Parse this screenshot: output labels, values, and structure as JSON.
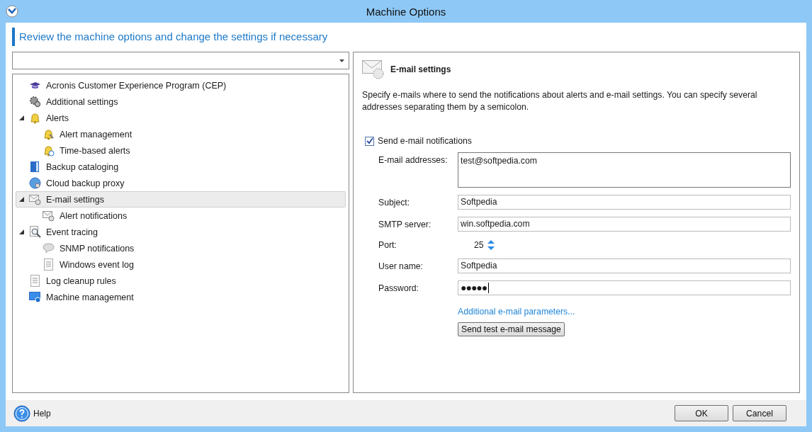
{
  "window": {
    "title": "Machine Options"
  },
  "header": "Review the machine options and change the settings if necessary",
  "tree": [
    {
      "label": "Acronis Customer Experience Program (CEP)",
      "kind": "program",
      "selected": false
    },
    {
      "label": "Additional settings",
      "kind": "gears",
      "selected": false
    },
    {
      "label": "Alerts",
      "kind": "bell",
      "selected": false,
      "expanded": true,
      "children": [
        {
          "label": "Alert management",
          "kind": "bellwrench",
          "selected": false
        },
        {
          "label": "Time-based alerts",
          "kind": "bellclock",
          "selected": false
        }
      ]
    },
    {
      "label": "Backup cataloging",
      "kind": "book",
      "selected": false
    },
    {
      "label": "Cloud backup proxy",
      "kind": "globe",
      "selected": false
    },
    {
      "label": "E-mail settings",
      "kind": "mail",
      "selected": true,
      "expanded": true,
      "children": [
        {
          "label": "Alert notifications",
          "kind": "mail",
          "selected": false
        }
      ]
    },
    {
      "label": "Event tracing",
      "kind": "magnifier",
      "selected": false,
      "expanded": true,
      "children": [
        {
          "label": "SNMP notifications",
          "kind": "bubble",
          "selected": false
        },
        {
          "label": "Windows event log",
          "kind": "log",
          "selected": false
        }
      ]
    },
    {
      "label": "Log cleanup rules",
      "kind": "log",
      "selected": false
    },
    {
      "label": "Machine management",
      "kind": "monitor",
      "selected": false
    }
  ],
  "panel": {
    "title": "E-mail settings",
    "description": "Specify e-mails where to send the notifications about alerts and e-mail settings. You can specify several addresses separating them by a semicolon.",
    "send_notifications": {
      "label": "Send e-mail notifications",
      "checked": true
    },
    "fields": [
      {
        "label": "E-mail addresses:",
        "value": "test@softpedia.com",
        "kind": "multiline"
      },
      {
        "label": "Subject:",
        "value": "Softpedia",
        "kind": "text"
      },
      {
        "label": "SMTP server:",
        "value": "win.softpedia.com",
        "kind": "text"
      },
      {
        "label": "Port:",
        "value": "25",
        "kind": "spinner"
      },
      {
        "label": "User name:",
        "value": "Softpedia",
        "kind": "text"
      },
      {
        "label": "Password:",
        "value": "●●●●●",
        "kind": "password"
      }
    ],
    "link": "Additional e-mail parameters...",
    "test_button": "Send test e-mail message"
  },
  "footer": {
    "help": "Help",
    "buttons": [
      "OK",
      "Cancel"
    ]
  }
}
